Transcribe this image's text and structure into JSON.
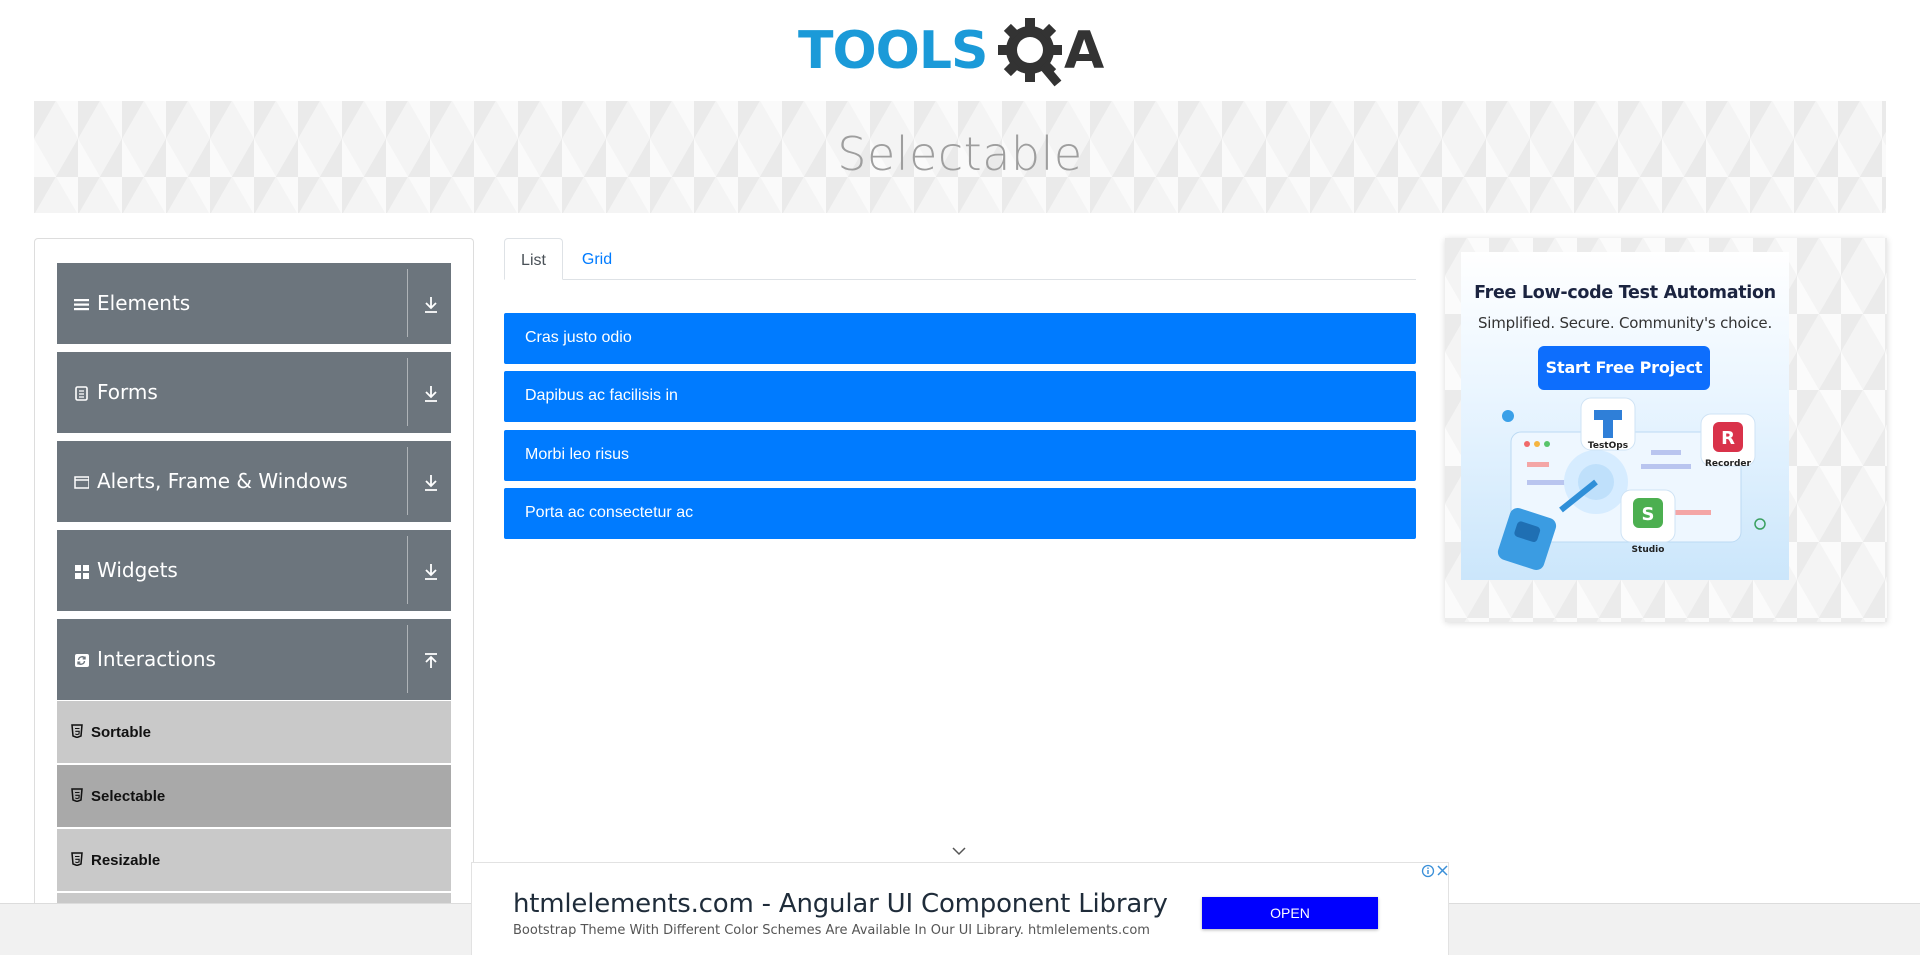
{
  "logo": {
    "text": "TOOLSQA",
    "colors": {
      "tools": "#1b9ad8",
      "gear": "#333333"
    }
  },
  "banner": {
    "title": "Selectable"
  },
  "sidebar": {
    "groups": [
      {
        "label": "Elements",
        "icon": "hamburger-icon",
        "expanded": false
      },
      {
        "label": "Forms",
        "icon": "document-icon",
        "expanded": false
      },
      {
        "label": "Alerts, Frame & Windows",
        "icon": "window-icon",
        "expanded": false
      },
      {
        "label": "Widgets",
        "icon": "grid-icon",
        "expanded": false
      },
      {
        "label": "Interactions",
        "icon": "sync-icon",
        "expanded": true
      }
    ],
    "subitems": [
      {
        "label": "Sortable",
        "active": false
      },
      {
        "label": "Selectable",
        "active": true
      },
      {
        "label": "Resizable",
        "active": false
      }
    ]
  },
  "tabs": [
    {
      "label": "List",
      "active": true
    },
    {
      "label": "Grid",
      "active": false
    }
  ],
  "list_items": [
    "Cras justo odio",
    "Dapibus ac facilisis in",
    "Morbi leo risus",
    "Porta ac consectetur ac"
  ],
  "right_ad": {
    "headline": "Free Low-code Test Automation",
    "subline": "Simplified. Secure. Community's choice.",
    "button": "Start Free Project",
    "products": [
      "TestOps",
      "Recorder",
      "Studio"
    ]
  },
  "bottom_ad": {
    "title": "htmlelements.com - Angular UI Component Library",
    "description": "Bootstrap Theme With Different Color Schemes Are Available In Our UI Library. htmlelements.com",
    "button": "OPEN"
  },
  "colors": {
    "primary": "#007bff",
    "sidebar_group": "#6c757d",
    "sub_item": "#c9c9c9",
    "sub_item_active": "#a9a9a9",
    "ad_button": "#0000ff"
  }
}
